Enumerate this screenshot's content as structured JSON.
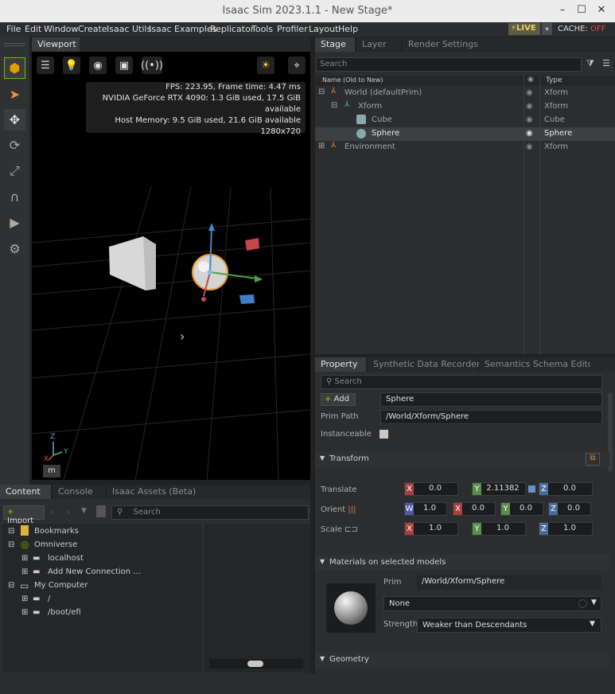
{
  "window": {
    "title": "Isaac Sim 2023.1.1 - New Stage*"
  },
  "menu": [
    "File",
    "Edit",
    "Window",
    "Create",
    "Isaac Utils",
    "Isaac Examples",
    "Replicator",
    "Tools",
    "Profiler",
    "Layout",
    "Help"
  ],
  "status": {
    "live": "LIVE",
    "cache_label": "CACHE:",
    "cache_state": "OFF"
  },
  "viewport": {
    "tab": "Viewport",
    "stats": {
      "fps": "FPS: 223.95, Frame time: 4.47 ms",
      "gpu": "NVIDIA GeForce RTX 4090: 1.3 GiB used, 17.5 GiB available",
      "host": "Host Memory: 9.5 GiB used, 21.6 GiB available",
      "res": "1280x720"
    },
    "units": "m",
    "axes": {
      "x": "X",
      "y": "Y",
      "z": "Z"
    }
  },
  "stage": {
    "tabs": [
      "Stage",
      "Layer",
      "Render Settings"
    ],
    "search_placeholder": "Search",
    "col_name": "Name (Old to New)",
    "col_type": "Type",
    "rows": [
      {
        "name": "World (defaultPrim)",
        "type": "Xform"
      },
      {
        "name": "Xform",
        "type": "Xform"
      },
      {
        "name": "Cube",
        "type": "Cube"
      },
      {
        "name": "Sphere",
        "type": "Sphere"
      },
      {
        "name": "Environment",
        "type": "Xform"
      }
    ]
  },
  "property": {
    "tabs": [
      "Property",
      "Synthetic Data Recorder",
      "Semantics Schema Editor"
    ],
    "search_placeholder": "Search",
    "add_label": "Add",
    "name_value": "Sphere",
    "prim_path_label": "Prim Path",
    "prim_path_value": "/World/Xform/Sphere",
    "instanceable_label": "Instanceable",
    "transform_label": "Transform",
    "translate_label": "Translate",
    "orient_label": "Orient",
    "scale_label": "Scale",
    "translate": {
      "x": "0.0",
      "y": "2.11382",
      "z": "0.0"
    },
    "orient": {
      "w": "1.0",
      "x": "0.0",
      "y": "0.0",
      "z": "0.0"
    },
    "scale": {
      "x": "1.0",
      "y": "1.0",
      "z": "1.0"
    },
    "materials_label": "Materials on selected models",
    "mat_prim_label": "Prim",
    "mat_prim_value": "/World/Xform/Sphere",
    "mat_value": "None",
    "strength_label": "Strength",
    "strength_value": "Weaker than Descendants",
    "geometry_label": "Geometry"
  },
  "content": {
    "tabs": [
      "Content",
      "Console",
      "Isaac Assets (Beta)"
    ],
    "import_label": "Import",
    "search_placeholder": "Search",
    "tree": [
      "Bookmarks",
      "Omniverse",
      "localhost",
      "Add New Connection ...",
      "My Computer",
      "/",
      "/boot/efi"
    ]
  },
  "colors": {
    "accent": "#76b900",
    "selection": "#3d3f41",
    "live": "#e8d75b",
    "cache_off": "#e24a4a"
  }
}
